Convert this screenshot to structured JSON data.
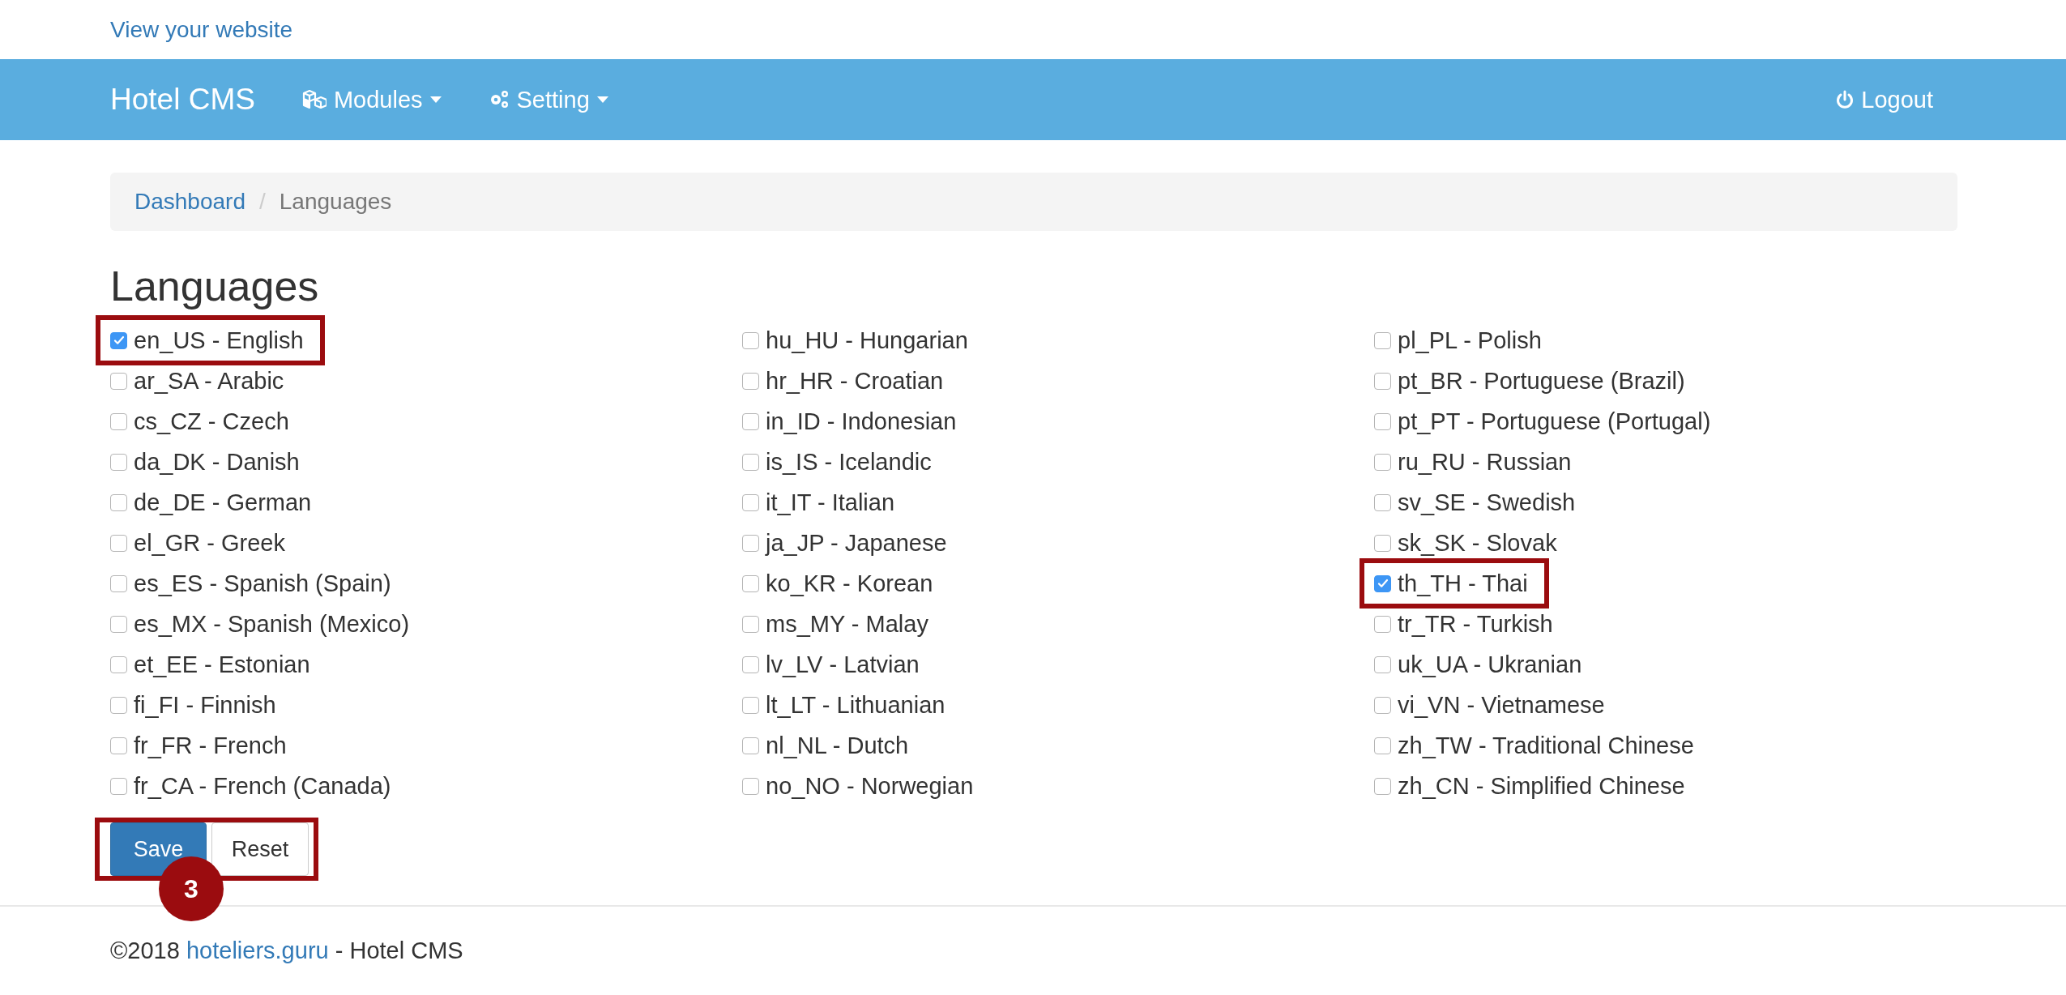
{
  "top_link": "View your website",
  "navbar": {
    "brand": "Hotel CMS",
    "menus": [
      {
        "label": "Modules"
      },
      {
        "label": "Setting"
      }
    ],
    "logout": "Logout"
  },
  "breadcrumb": {
    "separator": "/",
    "items": [
      {
        "label": "Dashboard",
        "kind": "link"
      },
      {
        "label": "Languages",
        "kind": "current"
      }
    ]
  },
  "heading": "Languages",
  "language_columns": [
    [
      {
        "label": "en_US - English",
        "checked": true,
        "highlighted": true
      },
      {
        "label": "ar_SA - Arabic",
        "checked": false,
        "highlighted": false
      },
      {
        "label": "cs_CZ - Czech",
        "checked": false,
        "highlighted": false
      },
      {
        "label": "da_DK - Danish",
        "checked": false,
        "highlighted": false
      },
      {
        "label": "de_DE - German",
        "checked": false,
        "highlighted": false
      },
      {
        "label": "el_GR - Greek",
        "checked": false,
        "highlighted": false
      },
      {
        "label": "es_ES - Spanish (Spain)",
        "checked": false,
        "highlighted": false
      },
      {
        "label": "es_MX - Spanish (Mexico)",
        "checked": false,
        "highlighted": false
      },
      {
        "label": "et_EE - Estonian",
        "checked": false,
        "highlighted": false
      },
      {
        "label": "fi_FI - Finnish",
        "checked": false,
        "highlighted": false
      },
      {
        "label": "fr_FR - French",
        "checked": false,
        "highlighted": false
      },
      {
        "label": "fr_CA - French (Canada)",
        "checked": false,
        "highlighted": false
      }
    ],
    [
      {
        "label": "hu_HU - Hungarian",
        "checked": false,
        "highlighted": false
      },
      {
        "label": "hr_HR - Croatian",
        "checked": false,
        "highlighted": false
      },
      {
        "label": "in_ID - Indonesian",
        "checked": false,
        "highlighted": false
      },
      {
        "label": "is_IS - Icelandic",
        "checked": false,
        "highlighted": false
      },
      {
        "label": "it_IT - Italian",
        "checked": false,
        "highlighted": false
      },
      {
        "label": "ja_JP - Japanese",
        "checked": false,
        "highlighted": false
      },
      {
        "label": "ko_KR - Korean",
        "checked": false,
        "highlighted": false
      },
      {
        "label": "ms_MY - Malay",
        "checked": false,
        "highlighted": false
      },
      {
        "label": "lv_LV - Latvian",
        "checked": false,
        "highlighted": false
      },
      {
        "label": "lt_LT - Lithuanian",
        "checked": false,
        "highlighted": false
      },
      {
        "label": "nl_NL - Dutch",
        "checked": false,
        "highlighted": false
      },
      {
        "label": "no_NO - Norwegian",
        "checked": false,
        "highlighted": false
      }
    ],
    [
      {
        "label": "pl_PL - Polish",
        "checked": false,
        "highlighted": false
      },
      {
        "label": "pt_BR - Portuguese (Brazil)",
        "checked": false,
        "highlighted": false
      },
      {
        "label": "pt_PT - Portuguese (Portugal)",
        "checked": false,
        "highlighted": false
      },
      {
        "label": "ru_RU - Russian",
        "checked": false,
        "highlighted": false
      },
      {
        "label": "sv_SE - Swedish",
        "checked": false,
        "highlighted": false
      },
      {
        "label": "sk_SK - Slovak",
        "checked": false,
        "highlighted": false
      },
      {
        "label": "th_TH - Thai",
        "checked": true,
        "highlighted": true
      },
      {
        "label": "tr_TR - Turkish",
        "checked": false,
        "highlighted": false
      },
      {
        "label": "uk_UA - Ukranian",
        "checked": false,
        "highlighted": false
      },
      {
        "label": "vi_VN - Vietnamese",
        "checked": false,
        "highlighted": false
      },
      {
        "label": "zh_TW - Traditional Chinese",
        "checked": false,
        "highlighted": false
      },
      {
        "label": "zh_CN - Simplified Chinese",
        "checked": false,
        "highlighted": false
      }
    ]
  ],
  "buttons": {
    "highlighted": true,
    "callout": "3",
    "items": [
      {
        "label": "Save",
        "kind": "primary"
      },
      {
        "label": "Reset",
        "kind": "default"
      }
    ]
  },
  "footer": {
    "prefix": "©2018",
    "link": "hoteliers.guru",
    "suffix": "- Hotel CMS"
  }
}
